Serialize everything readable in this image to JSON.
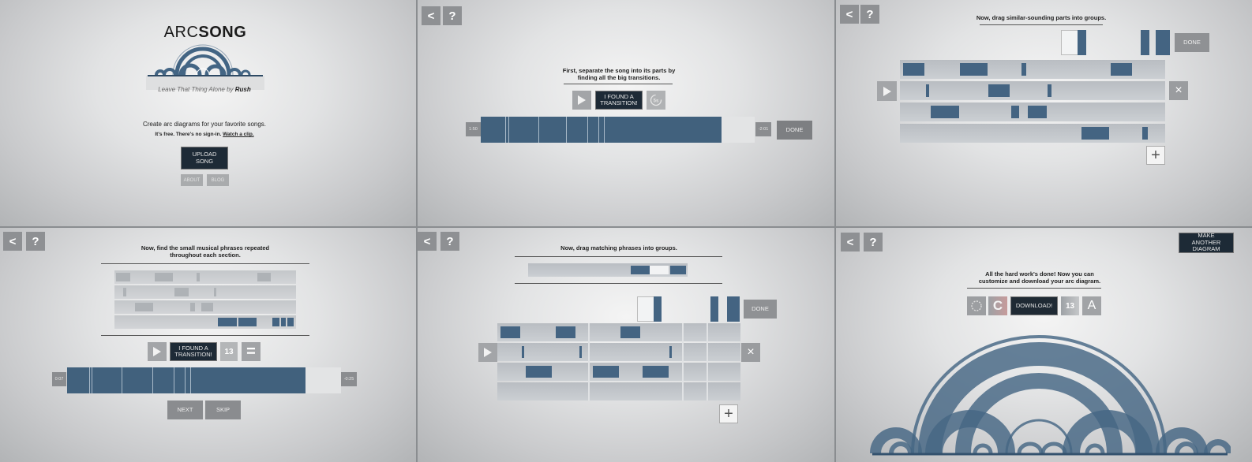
{
  "panel1": {
    "logo_light": "ARC",
    "logo_bold": "SONG",
    "song_caption_prefix": "Leave That Thing Alone by ",
    "song_artist": "Rush",
    "tagline": "Create arc diagrams for your favorite songs.",
    "free_text": "It's free. There's no sign-in. ",
    "watch_clip": "Watch a clip.",
    "upload_label": "UPLOAD SONG",
    "about_label": "ABOUT",
    "blog_label": "BLOG"
  },
  "panel2": {
    "back_icon": "<",
    "help_icon": "?",
    "instruction": "First, separate the song into its parts by finding all the big transitions.",
    "found_label": "I FOUND A TRANSITION!",
    "replay_icon": "rewind-5s-icon",
    "replay_label": "5s",
    "time_elapsed": "1:50",
    "time_remaining": "-2:01",
    "done_label": "DONE",
    "progress": 0.88
  },
  "panel3": {
    "back_icon": "<",
    "help_icon": "?",
    "instruction": "Now, drag similar-sounding parts into groups.",
    "done_label": "DONE",
    "close_icon": "×",
    "add_icon": "+"
  },
  "panel4": {
    "back_icon": "<",
    "help_icon": "?",
    "instruction": "Now, find the small musical phrases repeated throughout each section.",
    "found_label": "I FOUND A TRANSITION!",
    "counter": "13",
    "equals_icon": "=",
    "time_elapsed": "0:07",
    "time_remaining": "-0:25",
    "next_label": "NEXT",
    "skip_label": "SKIP",
    "progress": 0.87
  },
  "panel5": {
    "back_icon": "<",
    "help_icon": "?",
    "instruction": "Now, drag matching phrases into groups.",
    "done_label": "DONE",
    "close_icon": "×",
    "add_icon": "+"
  },
  "panel6": {
    "back_icon": "<",
    "help_icon": "?",
    "make_another_label": "MAKE ANOTHER DIAGRAM",
    "instruction": "All the hard work's done! Now you can customize and download your arc diagram.",
    "c_label": "C",
    "download_label": "DOWNLOAD!",
    "size_label": "13",
    "font_label": "A"
  },
  "colors": {
    "accent": "#41617d",
    "dark_button": "#1d2a36",
    "panel_bg": "#e2e3e4"
  }
}
